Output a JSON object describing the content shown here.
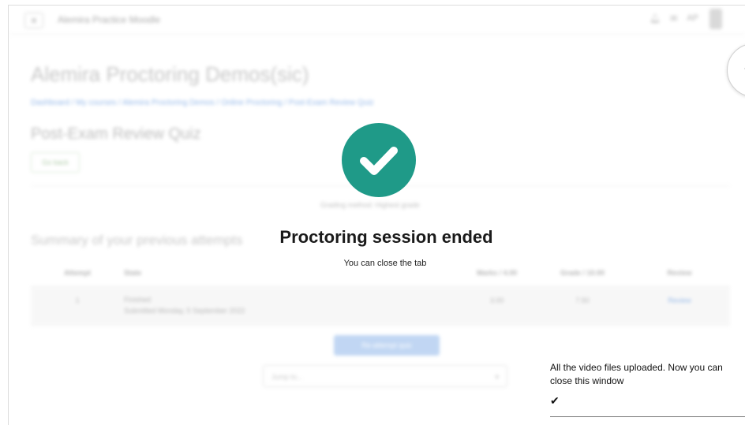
{
  "header": {
    "menu_icon": "hamburger-icon",
    "site_name": "Alemira Practice Moodle",
    "icons": [
      "bell-icon",
      "chat-icon"
    ],
    "user_initials": "AP"
  },
  "page": {
    "course_title": "Alemira Proctoring Demos(sic)",
    "breadcrumb": "Dashboard / My courses / Alemira Proctoring Demos / Online Proctoring / Post-Exam Review Quiz",
    "quiz_title": "Post-Exam Review Quiz",
    "back_label": "Go back",
    "grading_text": "Grading method: Highest grade",
    "summary_heading": "Summary of your previous attempts",
    "table": {
      "headers": [
        "Attempt",
        "State",
        "Marks / 4.00",
        "Grade / 10.00",
        "Review"
      ],
      "rows": [
        {
          "attempt": "1",
          "state": "Finished",
          "submitted": "Submitted Monday, 5 September 2022",
          "marks": "3.00",
          "grade": "7.50",
          "review": "Review"
        }
      ]
    },
    "reattempt_label": "Re-attempt quiz",
    "jump_placeholder": "Jump to...",
    "jump_arrow": "▾"
  },
  "overlay": {
    "check_icon": "check-circle-icon",
    "title": "Proctoring session ended",
    "subtitle": "You can close the tab",
    "accent": "#1f9a88"
  },
  "extension": {
    "toggle_icon": "double-chevron-left-icon",
    "toggle_glyph": "«",
    "upload_message": "All the video files uploaded. Now you can close this window",
    "upload_check": "✔"
  }
}
